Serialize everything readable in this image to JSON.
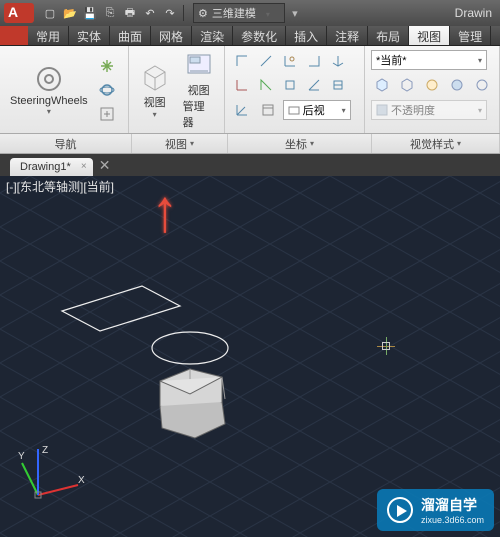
{
  "title_right": "Drawin",
  "workspace_selector": "三维建模",
  "ribbon_tabs": [
    "常用",
    "实体",
    "曲面",
    "网格",
    "渲染",
    "参数化",
    "插入",
    "注释",
    "布局",
    "视图",
    "管理"
  ],
  "active_ribbon_tab": "视图",
  "panels": {
    "nav": {
      "title": "导航",
      "steering": "SteeringWheels"
    },
    "view": {
      "title": "视图",
      "view_btn": "视图",
      "view_mgr_l1": "视图",
      "view_mgr_l2": "管理器"
    },
    "coord": {
      "title": "坐标",
      "back_view": "后视"
    },
    "visual": {
      "title": "视觉样式",
      "current": "*当前*",
      "opacity": "不透明度"
    }
  },
  "panel_bar": [
    "导航",
    "视图",
    "坐标",
    "视觉样式"
  ],
  "doc_tab": "Drawing1*",
  "viewport_label": "[-][东北等轴测][当前]",
  "watermark": {
    "line1": "溜溜自学",
    "line2": "zixue.3d66.com"
  }
}
